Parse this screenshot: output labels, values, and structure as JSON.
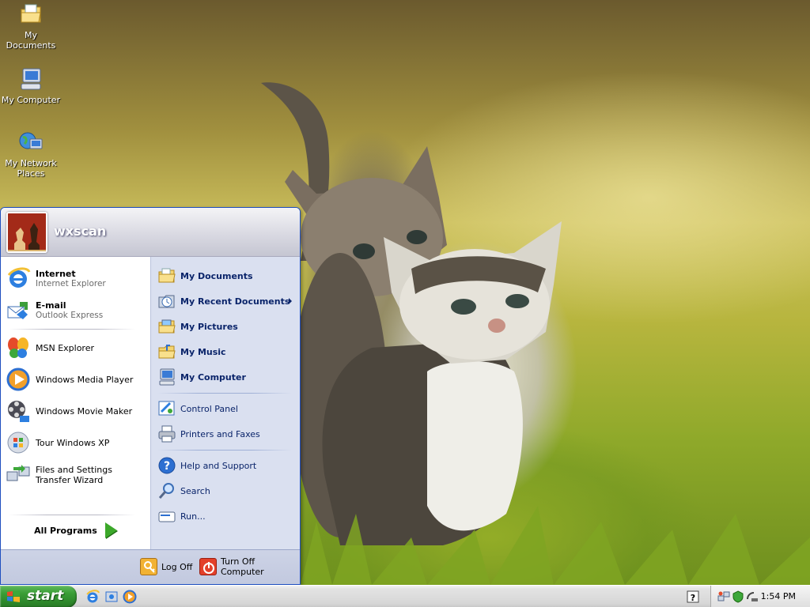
{
  "desktop": {
    "icons": [
      {
        "label": "My Documents",
        "icon": "folder-documents-icon"
      },
      {
        "label": "My Computer",
        "icon": "computer-icon"
      },
      {
        "label": "My Network Places",
        "icon": "network-places-icon"
      }
    ]
  },
  "start_menu": {
    "username": "wxscan",
    "pinned": [
      {
        "title": "Internet",
        "subtitle": "Internet Explorer",
        "icon": "internet-explorer-icon"
      },
      {
        "title": "E-mail",
        "subtitle": "Outlook Express",
        "icon": "outlook-express-icon"
      }
    ],
    "recent": [
      {
        "label": "MSN Explorer",
        "icon": "msn-butterfly-icon"
      },
      {
        "label": "Windows Media Player",
        "icon": "media-player-icon"
      },
      {
        "label": "Windows Movie Maker",
        "icon": "movie-maker-icon"
      },
      {
        "label": "Tour Windows XP",
        "icon": "tour-xp-icon"
      },
      {
        "label": "Files and Settings Transfer Wizard",
        "icon": "transfer-wizard-icon"
      }
    ],
    "all_programs": "All Programs",
    "places": [
      {
        "label": "My Documents",
        "icon": "folder-documents-icon"
      },
      {
        "label": "My Recent Documents",
        "icon": "recent-documents-icon"
      },
      {
        "label": "My Pictures",
        "icon": "folder-pictures-icon"
      },
      {
        "label": "My Music",
        "icon": "folder-music-icon"
      },
      {
        "label": "My Computer",
        "icon": "computer-icon"
      }
    ],
    "settings": [
      {
        "label": "Control Panel",
        "icon": "control-panel-icon"
      },
      {
        "label": "Printers and Faxes",
        "icon": "printer-icon"
      }
    ],
    "help": [
      {
        "label": "Help and Support",
        "icon": "help-icon"
      },
      {
        "label": "Search",
        "icon": "search-icon"
      },
      {
        "label": "Run...",
        "icon": "run-icon"
      }
    ],
    "footer": {
      "log_off": "Log Off",
      "turn_off": "Turn Off Computer"
    }
  },
  "taskbar": {
    "start_label": "start",
    "clock": "1:54 PM"
  },
  "colors": {
    "start_green": "#3a9e36",
    "menu_blue": "#1f4fbf",
    "right_pane": "#dae0f0"
  }
}
